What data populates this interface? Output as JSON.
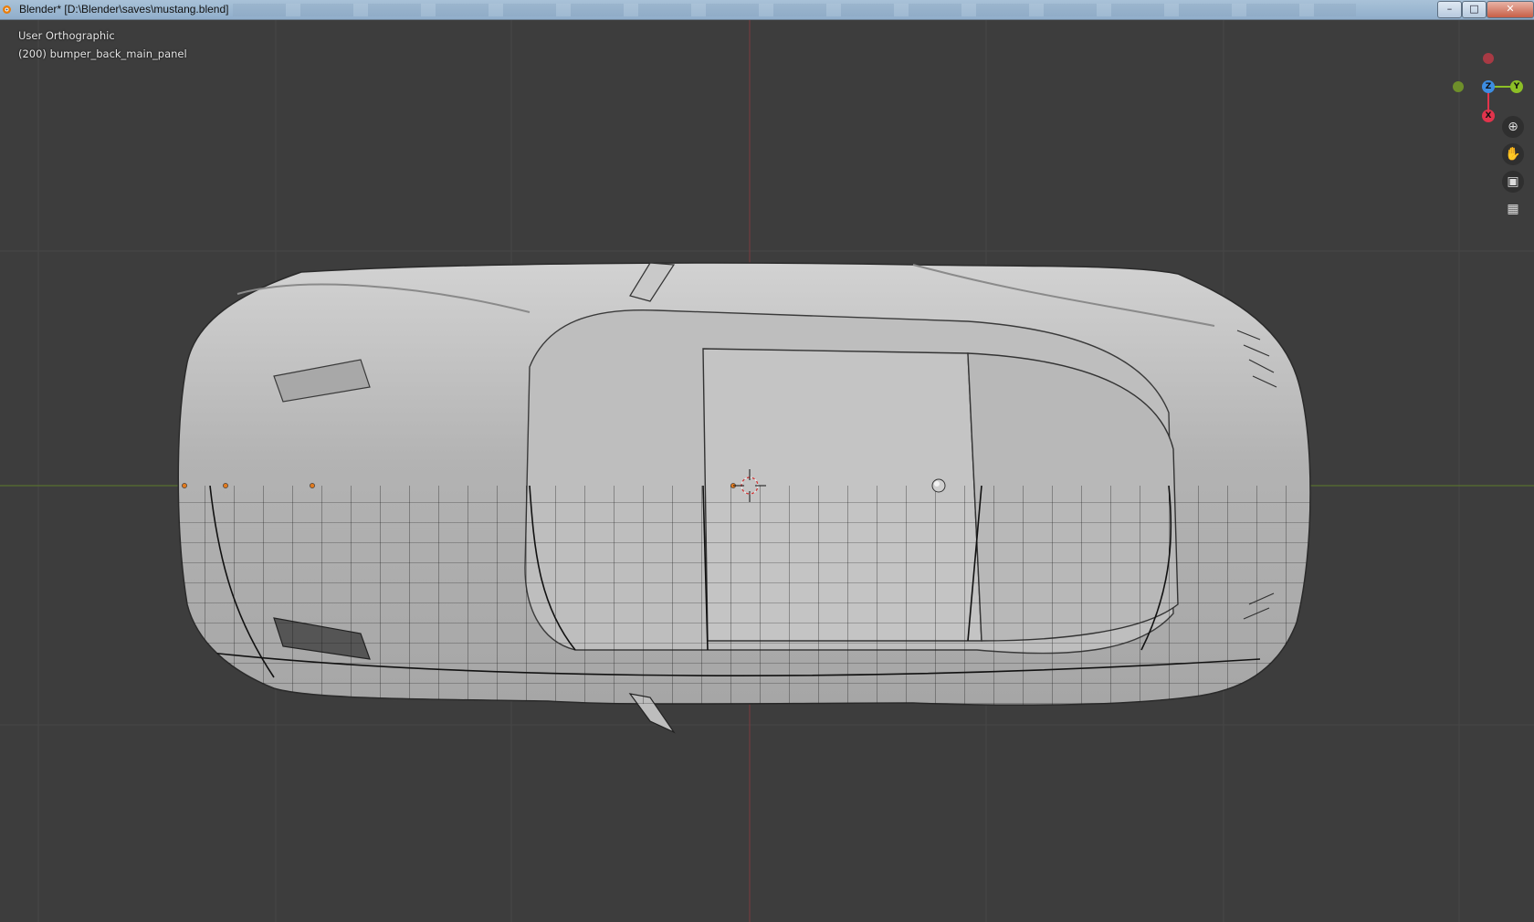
{
  "window": {
    "title": "Blender* [D:\\Blender\\saves\\mustang.blend]",
    "minimize_glyph": "–",
    "maximize_glyph": "□",
    "close_glyph": "✕"
  },
  "viewport": {
    "view_name": "User Orthographic",
    "active_object": "(200) bumper_back_main_panel"
  },
  "gizmo": {
    "axes": [
      {
        "label": "Y",
        "color": "#8cbf26"
      },
      {
        "label": "Z",
        "color": "#3d8de2"
      },
      {
        "label": "X",
        "color": "#e2344c"
      }
    ]
  },
  "nav_buttons": [
    {
      "name": "zoom-icon",
      "glyph": "⊕"
    },
    {
      "name": "pan-hand-icon",
      "glyph": "✋"
    },
    {
      "name": "camera-icon",
      "glyph": "▣"
    },
    {
      "name": "grid-icon",
      "glyph": "▦"
    }
  ],
  "colors": {
    "background": "#3d3d3d",
    "grid_line": "#484848",
    "x_axis": "#7a3a40",
    "y_axis": "#5d7a2a",
    "car_body": "#b4b4b4"
  }
}
